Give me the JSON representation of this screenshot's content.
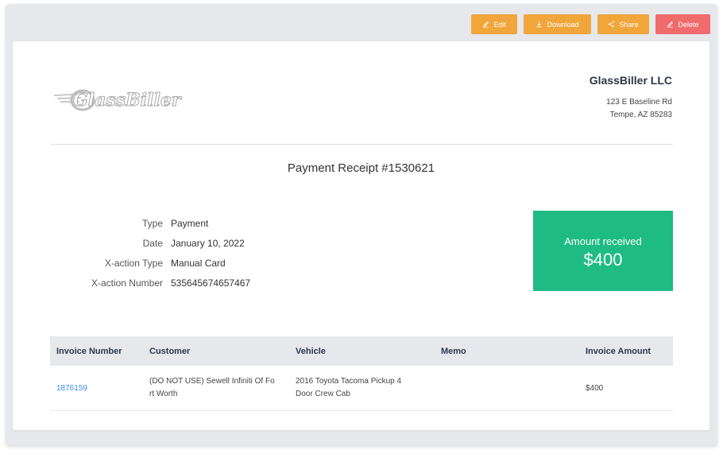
{
  "toolbar": {
    "edit_label": "Edit",
    "download_label": "Download",
    "share_label": "Share",
    "delete_label": "Delete"
  },
  "company": {
    "logo_text": "GlassBiller",
    "name": "GlassBiller LLC",
    "address_line1": "123 E Baseline Rd",
    "address_line2": "Tempe, AZ 85283"
  },
  "receipt": {
    "title": "Payment Receipt #1530621",
    "details": [
      {
        "label": "Type",
        "value": "Payment"
      },
      {
        "label": "Date",
        "value": "January 10, 2022"
      },
      {
        "label": "X-action Type",
        "value": "Manual Card"
      },
      {
        "label": "X-action Number",
        "value": "535645674657467"
      }
    ],
    "amount_label": "Amount received",
    "amount_value": "$400"
  },
  "table": {
    "headers": [
      "Invoice Number",
      "Customer",
      "Vehicle",
      "Memo",
      "Invoice Amount"
    ],
    "rows": [
      {
        "invoice_number": "1876159",
        "customer_line1": "(DO NOT USE) Sewell Infiniti Of Fo",
        "customer_line2": "rt Worth",
        "vehicle_line1": "2016 Toyota Tacoma Pickup 4",
        "vehicle_line2": "Door Crew Cab",
        "memo": "",
        "amount": "$400"
      }
    ]
  },
  "colors": {
    "button_orange": "#f0a63b",
    "button_red": "#f06b6b",
    "amount_green": "#1ebb84",
    "link_blue": "#3b8de0"
  }
}
